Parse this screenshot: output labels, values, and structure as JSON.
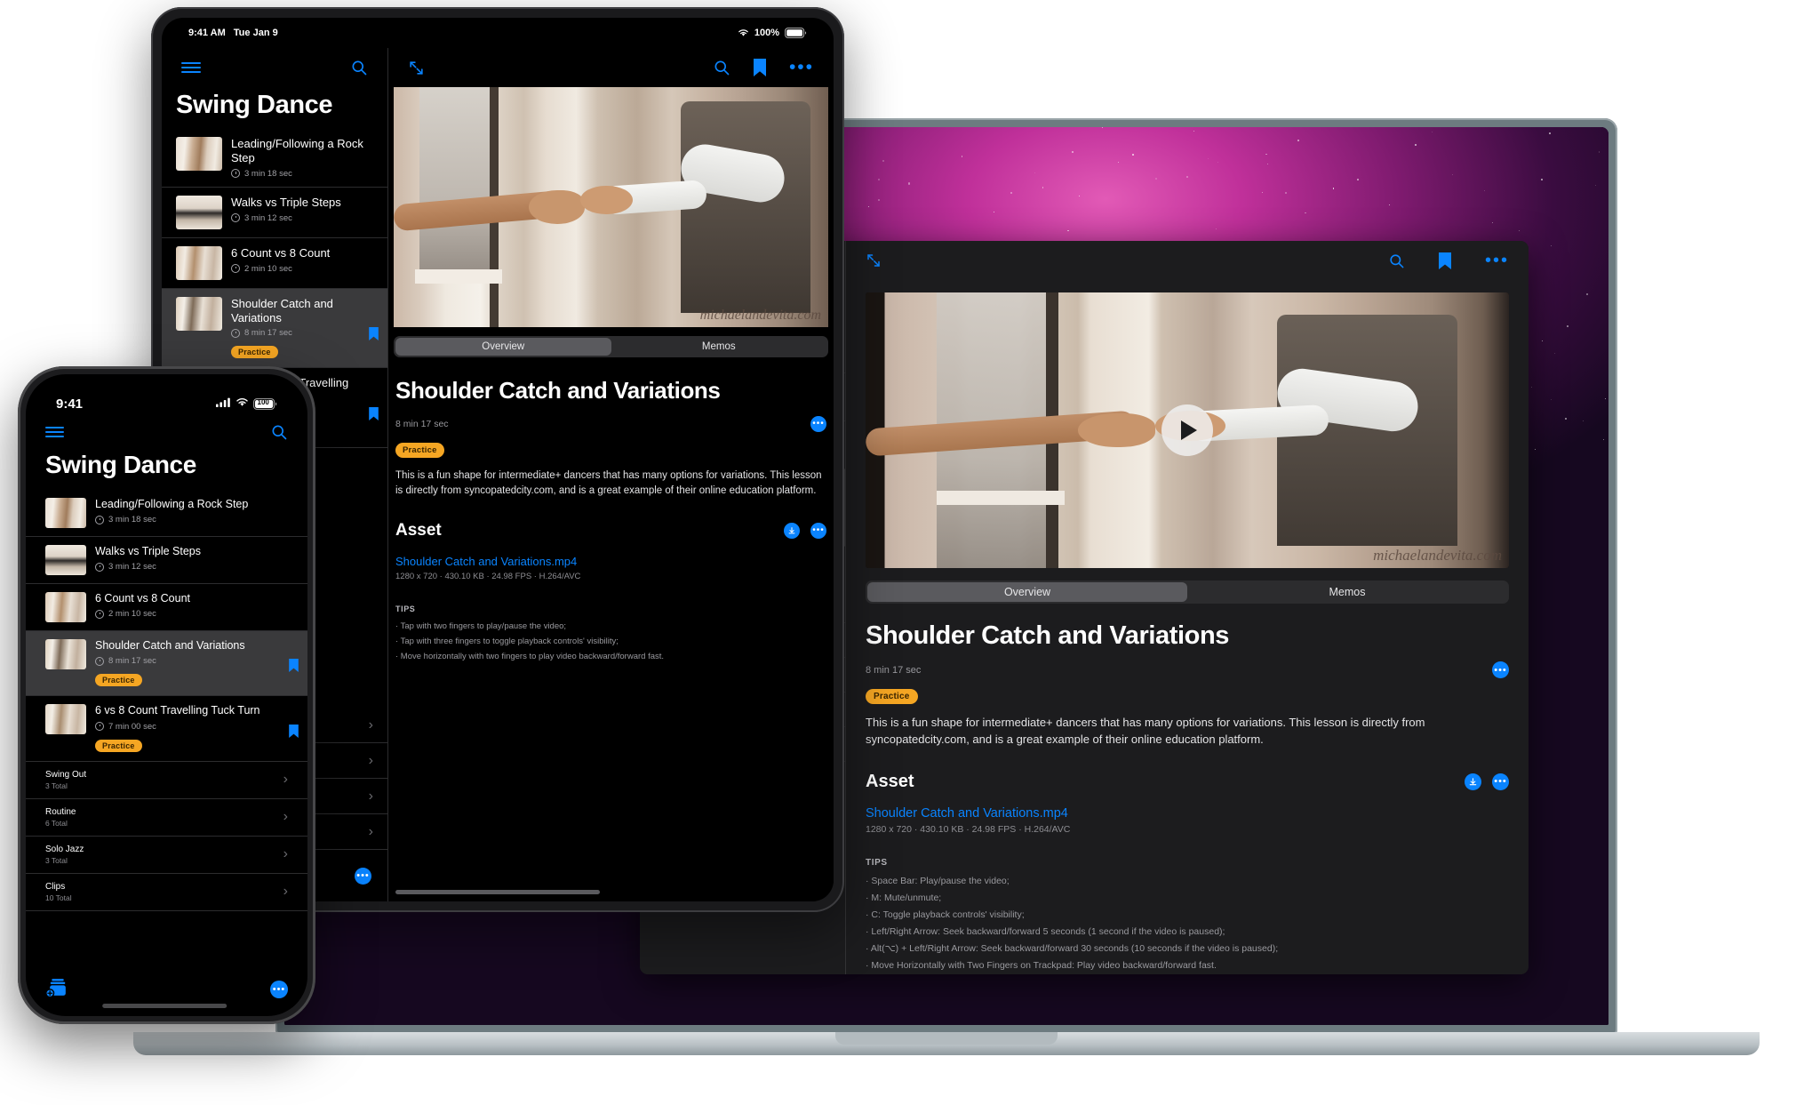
{
  "app": {
    "library_title": "Swing Dance",
    "lesson_detail": {
      "title": "Shoulder Catch and Variations",
      "duration": "8 min 17 sec",
      "tag": "Practice",
      "description": "This is a fun shape for intermediate+ dancers that has many options for variations. This lesson is directly from syncopatedcity.com, and is a great example of their online education platform.",
      "asset_heading": "Asset",
      "asset_filename": "Shoulder Catch and Variations.mp4",
      "asset_info": "1280 x 720 · 430.10 KB · 24.98 FPS · H.264/AVC",
      "tips_heading": "TIPS",
      "watermark": "michaelandevita.com"
    },
    "segments": {
      "overview": "Overview",
      "memos": "Memos",
      "selected": "Overview"
    },
    "lessons": [
      {
        "title": "Leading/Following a Rock Step",
        "duration": "3 min 18 sec",
        "tag": "",
        "bookmarked": false
      },
      {
        "title": "Walks vs Triple Steps",
        "duration": "3 min 12 sec",
        "tag": "",
        "bookmarked": false
      },
      {
        "title": "6 Count vs 8 Count",
        "duration": "2 min 10 sec",
        "tag": "",
        "bookmarked": false
      },
      {
        "title": "Shoulder Catch and Variations",
        "duration": "8 min 17 sec",
        "tag": "Practice",
        "bookmarked": true
      },
      {
        "title": "6 vs 8 Count Travelling Tuck Turn",
        "duration": "7 min 00 sec",
        "tag": "Practice",
        "bookmarked": true
      }
    ],
    "groups": [
      {
        "title": "Swing Out",
        "sub": "3 Total"
      },
      {
        "title": "Routine",
        "sub": "6 Total"
      },
      {
        "title": "Solo Jazz",
        "sub": "3 Total"
      },
      {
        "title": "Clips",
        "sub": "10 Total"
      }
    ],
    "tips_mac": [
      "Space Bar: Play/pause the video;",
      "M: Mute/unmute;",
      "C: Toggle playback controls' visibility;",
      "Left/Right Arrow: Seek backward/forward 5 seconds (1 second if the video is paused);",
      "Alt(⌥) + Left/Right Arrow: Seek backward/forward 30 seconds (10 seconds if the video is paused);",
      "Move Horizontally with Two Fingers on Trackpad: Play video backward/forward fast."
    ],
    "tips_ipad": [
      "Tap with two fingers to play/pause the video;",
      "Tap with three fingers to toggle playback controls' visibility;",
      "Move horizontally with two fingers to play video backward/forward fast."
    ]
  },
  "ipad_status": {
    "time": "9:41 AM",
    "date": "Tue Jan 9",
    "battery": "100%"
  },
  "iphone_status": {
    "time": "9:41",
    "battery": "100"
  },
  "icons": {
    "menu": "hamburger-menu-icon",
    "search": "search-icon",
    "bookmark": "bookmark-icon",
    "more": "ellipsis-icon",
    "expand": "expand-arrows-icon",
    "download": "download-icon",
    "add_library": "add-to-library-icon",
    "chevron": "chevron-right-icon",
    "play": "play-icon",
    "wifi": "wifi-icon",
    "cellular": "cellular-signal-icon"
  },
  "colors": {
    "accent": "#0a84ff",
    "badge": "#f5a623",
    "bg": "#000000",
    "panel": "#1c1c1e",
    "selected_row": "#3a3a3c"
  }
}
